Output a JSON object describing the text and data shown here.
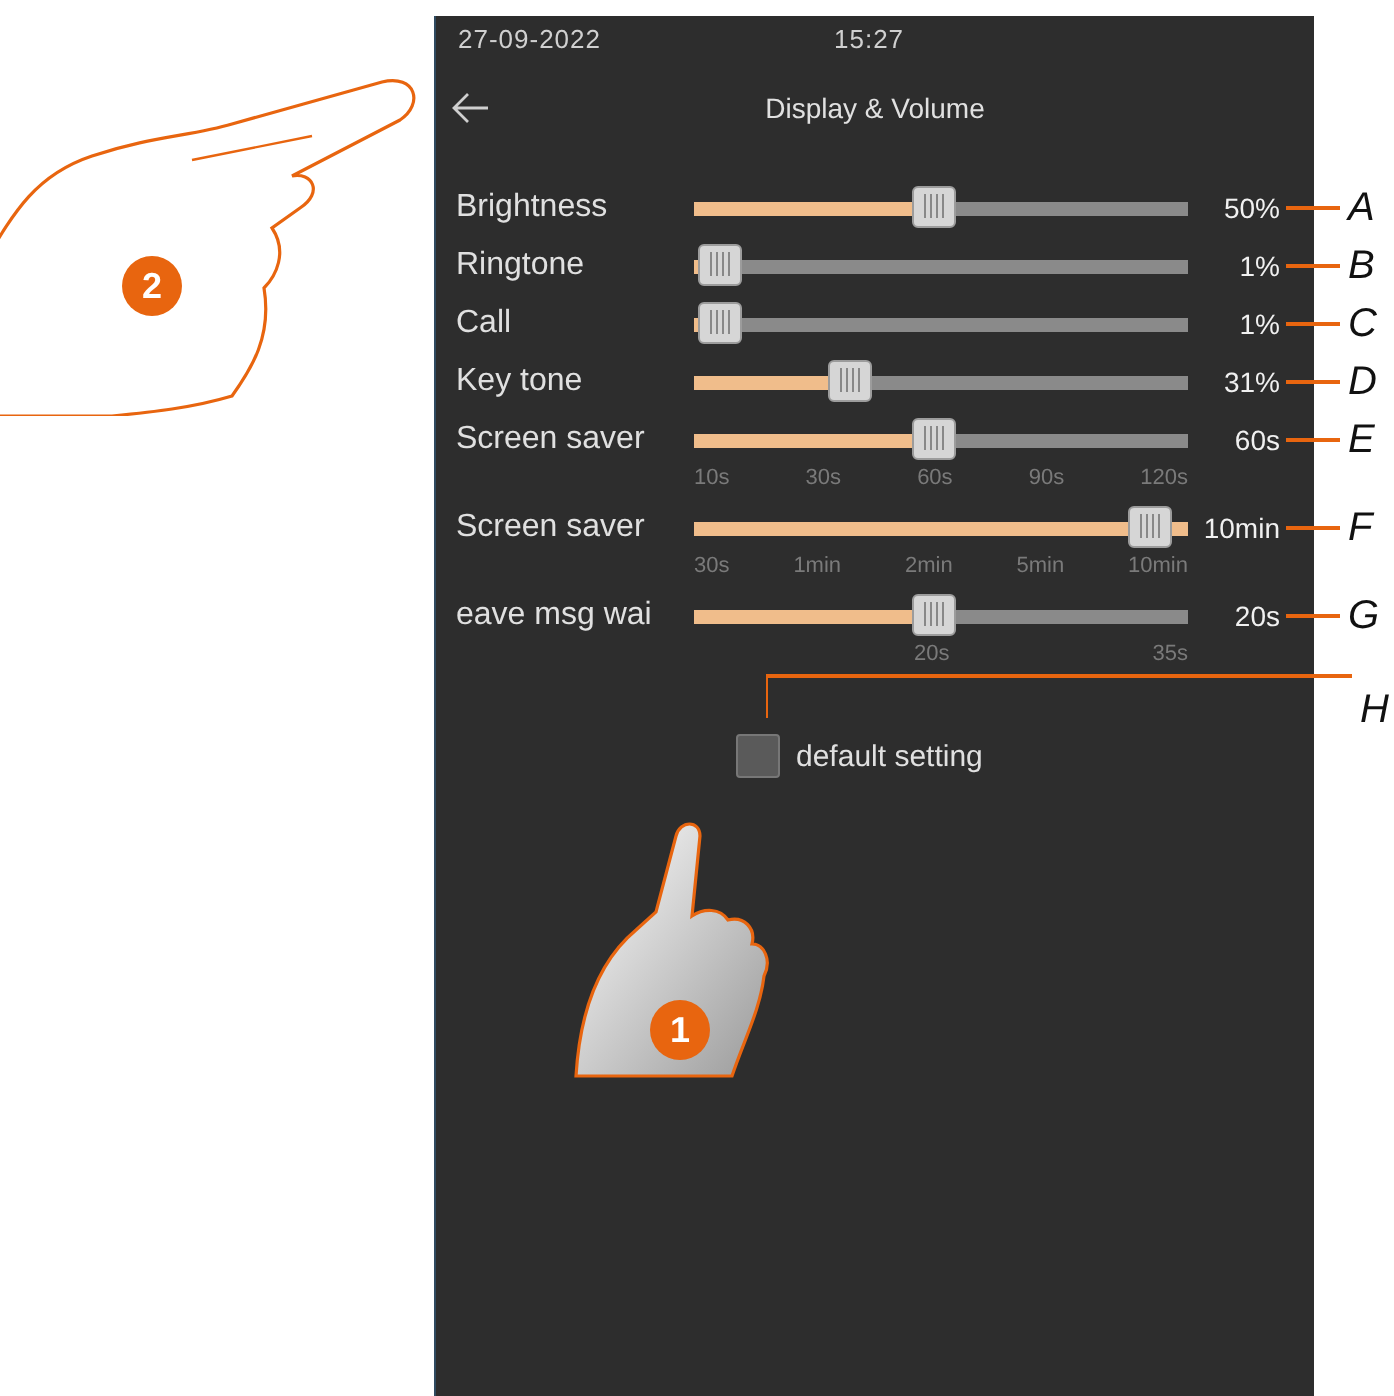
{
  "status_bar": {
    "date": "27-09-2022",
    "time": "15:27"
  },
  "header": {
    "title": "Display & Volume"
  },
  "sliders": [
    {
      "label": "Brightness",
      "level": 0.5,
      "reading": "50%",
      "callout": "A"
    },
    {
      "label": "Ringtone",
      "level": 0.01,
      "reading": "1%",
      "callout": "B"
    },
    {
      "label": "Call",
      "level": 0.01,
      "reading": "1%",
      "callout": "C"
    },
    {
      "label": "Key tone",
      "level": 0.31,
      "reading": "31%",
      "callout": "D"
    },
    {
      "label": "Screen saver",
      "level": 0.5,
      "reading": "60s",
      "callout": "E",
      "ticks": [
        "10s",
        "30s",
        "60s",
        "90s",
        "120s"
      ]
    },
    {
      "label": "Screen saver",
      "level": 1.0,
      "reading": "10min",
      "callout": "F",
      "ticks": [
        "30s",
        "1min",
        "2min",
        "5min",
        "10min"
      ]
    },
    {
      "label": "eave msg wai",
      "level": 0.5,
      "reading": "20s",
      "callout": "G",
      "ticks": [
        "20s",
        "35s"
      ]
    }
  ],
  "default_setting": {
    "label": "default setting",
    "checked": false,
    "callout": "H"
  },
  "steps": [
    {
      "number": "1",
      "kind": "tap"
    },
    {
      "number": "2",
      "kind": "back"
    }
  ]
}
